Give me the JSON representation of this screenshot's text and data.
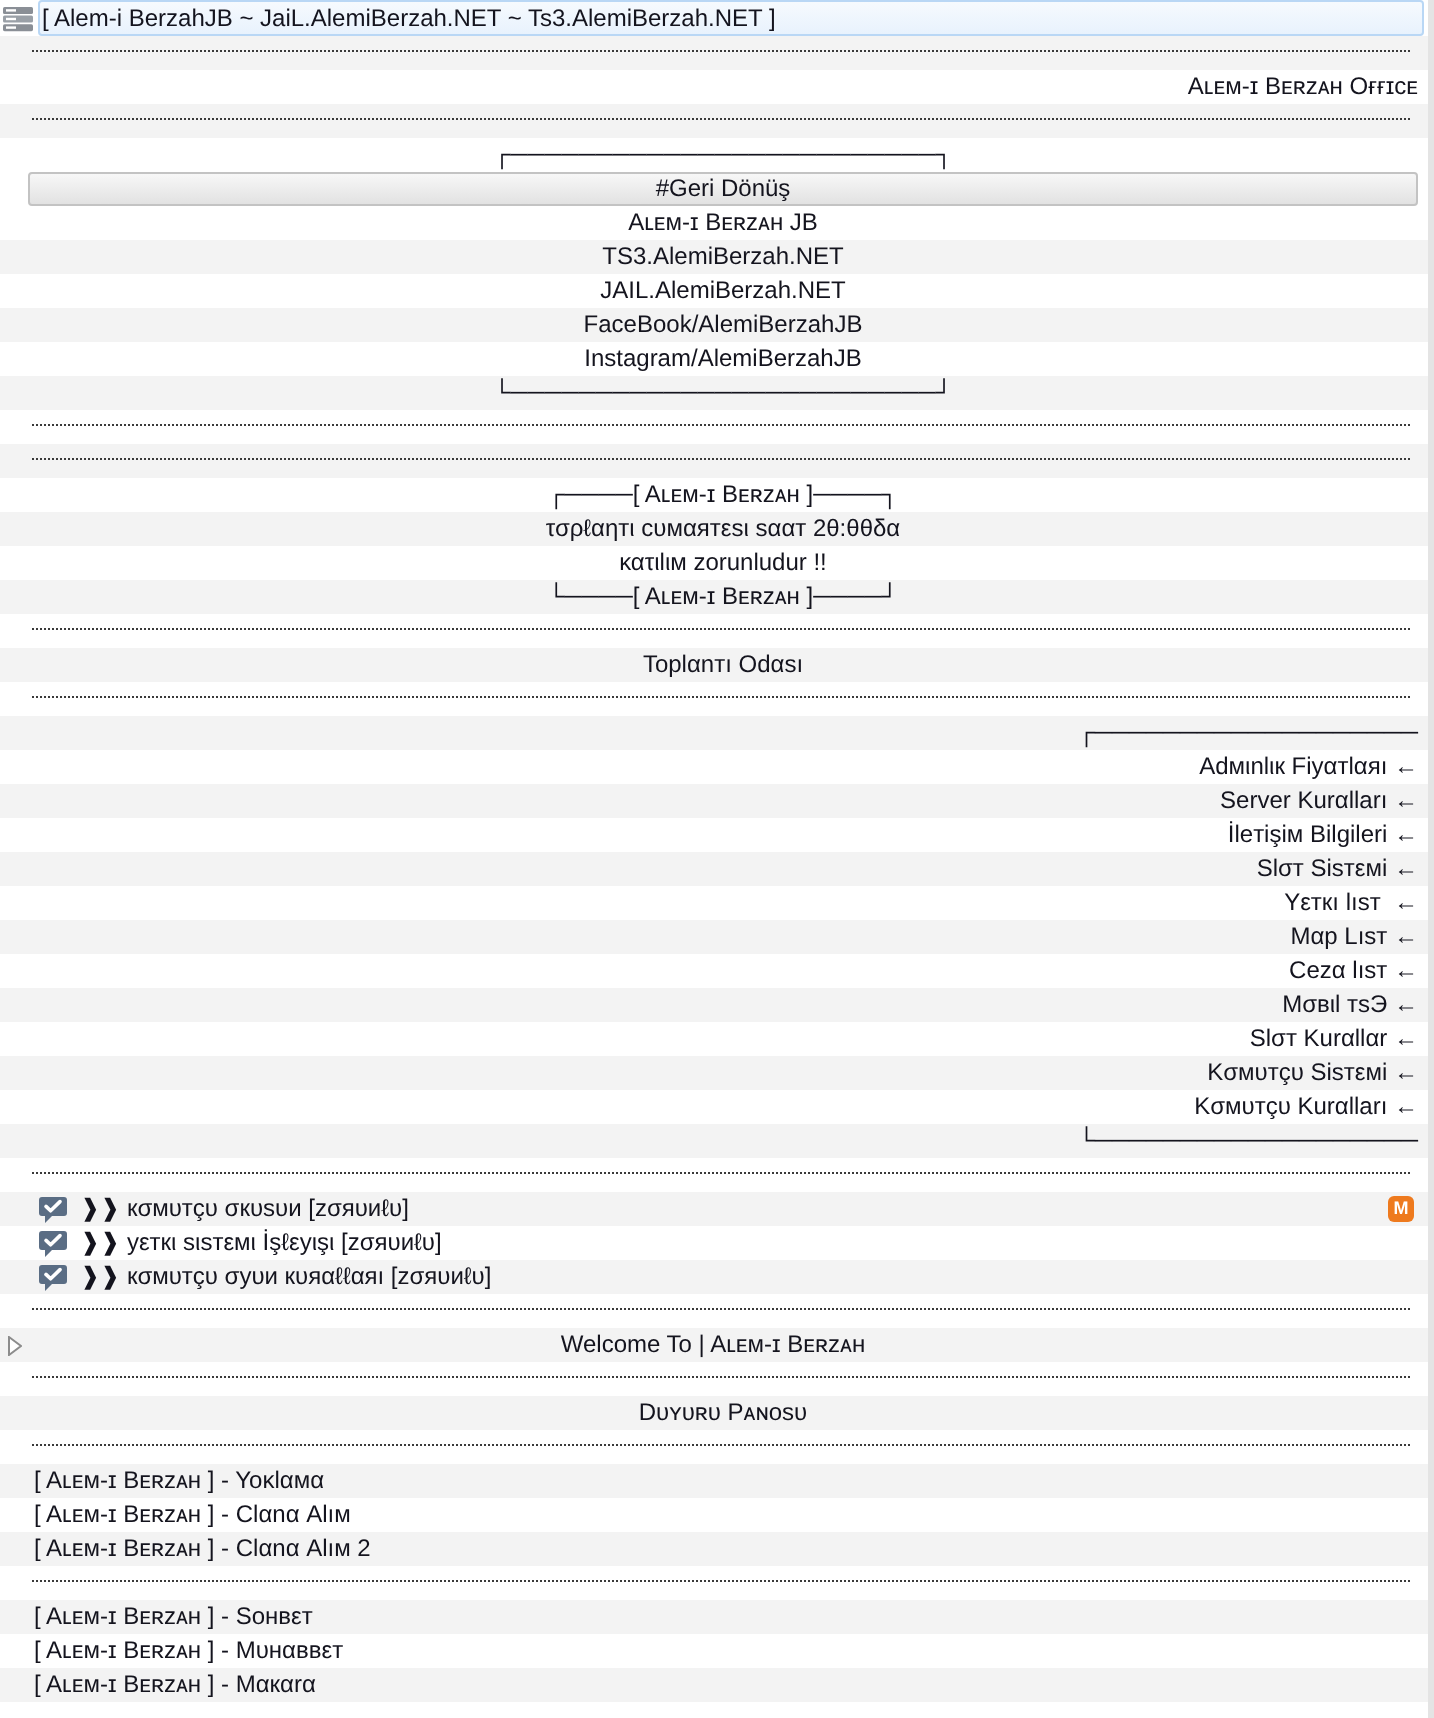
{
  "server": {
    "name": "[ Alem-i BerzahJB ~ JaiL.AlemiBerzah.NET ~ Ts3.AlemiBerzah.NET ]",
    "highlighted": true
  },
  "channels": [
    {
      "kind": "spacer",
      "selected": false
    },
    {
      "kind": "right",
      "text": "Aʟᴇᴍ-ɪ Bᴇʀᴢᴀʜ Oғғɪᴄᴇ",
      "selected": false
    },
    {
      "kind": "spacer",
      "selected": false
    },
    {
      "kind": "center",
      "text": "┌─────────────────────────┐",
      "selected": false
    },
    {
      "kind": "center",
      "text": "#Geri Dönüş",
      "selected": true
    },
    {
      "kind": "center",
      "text": "Aʟᴇᴍ-ɪ Bᴇʀᴢᴀʜ JB",
      "selected": false
    },
    {
      "kind": "center",
      "text": "TS3.AlemiBerzah.NET",
      "selected": false
    },
    {
      "kind": "center",
      "text": "JAIL.AlemiBerzah.NET",
      "selected": false
    },
    {
      "kind": "center",
      "text": "FaceBook/AlemiBerzahJB",
      "selected": false
    },
    {
      "kind": "center",
      "text": "Instagram/AlemiBerzahJB",
      "selected": false
    },
    {
      "kind": "center",
      "text": "└─────────────────────────┘",
      "selected": false
    },
    {
      "kind": "spacer",
      "selected": false
    },
    {
      "kind": "spacer",
      "selected": false
    },
    {
      "kind": "center",
      "text": "┌────[ Aʟᴇᴍ-ɪ Bᴇʀᴢᴀʜ ]────┐",
      "selected": false
    },
    {
      "kind": "center",
      "text": "τσρℓαηтι cυмαятεsι sααт 2θ:θθδα",
      "selected": false
    },
    {
      "kind": "center",
      "text": "κατιlιм zorunludur !!",
      "selected": false
    },
    {
      "kind": "center",
      "text": "└────[ Aʟᴇᴍ-ɪ Bᴇʀᴢᴀʜ ]────┘",
      "selected": false
    },
    {
      "kind": "spacer",
      "selected": false
    },
    {
      "kind": "center",
      "text": "Toplαnтı Odαsı",
      "selected": false
    },
    {
      "kind": "spacer",
      "selected": false
    },
    {
      "kind": "right",
      "text": "┌───────────────────",
      "selected": false
    },
    {
      "kind": "right",
      "text": "Adмιnlιк Fiyαтlαяı ←",
      "selected": false
    },
    {
      "kind": "right",
      "text": "Server Kurαlları ←",
      "selected": false
    },
    {
      "kind": "right",
      "text": "İleтişiм Bilgileri ←",
      "selected": false
    },
    {
      "kind": "right",
      "text": "Slσт Sisтεмi ←",
      "selected": false
    },
    {
      "kind": "right",
      "text": "Yεткı lısт  ←",
      "selected": false
    },
    {
      "kind": "right",
      "text": "Mαp Lısт ←",
      "selected": false
    },
    {
      "kind": "right",
      "text": "Cezα lısт ←",
      "selected": false
    },
    {
      "kind": "right",
      "text": "Mσвιl тsЭ ←",
      "selected": false
    },
    {
      "kind": "right",
      "text": "Slσт Kurαllαr ←",
      "selected": false
    },
    {
      "kind": "right",
      "text": "Kσмυтçυ Sisтεмi ←",
      "selected": false
    },
    {
      "kind": "right",
      "text": "Kσмυтçυ Kurαlları ←",
      "selected": false
    },
    {
      "kind": "right",
      "text": "└───────────────────",
      "selected": false
    },
    {
      "kind": "spacer",
      "selected": false
    },
    {
      "kind": "room",
      "text": "❱❱ кσмυтçυ σкυsυи [zσяυиℓυ]",
      "badge": "M",
      "selected": false
    },
    {
      "kind": "room",
      "text": "❱❱ уεткι sιsтεмι İşℓεyιşι [zσяυиℓυ]",
      "selected": false
    },
    {
      "kind": "room",
      "text": "❱❱ кσмυтçυ σуυи кυяαℓℓαяı [zσяυиℓυ]",
      "selected": false
    },
    {
      "kind": "spacer",
      "selected": false
    },
    {
      "kind": "group",
      "text": "Welcome To | Aʟᴇᴍ-ɪ Bᴇʀᴢᴀʜ",
      "expanded": false,
      "selected": false
    },
    {
      "kind": "spacer",
      "selected": false
    },
    {
      "kind": "center",
      "text": "Dᴜʏᴜʀᴜ Pᴀɴᴏsᴜ",
      "selected": false
    },
    {
      "kind": "spacer",
      "selected": false
    },
    {
      "kind": "left",
      "text": "[ Aʟᴇᴍ-ɪ Bᴇʀᴢᴀʜ ] - Yoκlαмα",
      "selected": false
    },
    {
      "kind": "left",
      "text": "[ Aʟᴇᴍ-ɪ Bᴇʀᴢᴀʜ ] - Clαnα Alıм",
      "selected": false
    },
    {
      "kind": "left",
      "text": "[ Aʟᴇᴍ-ɪ Bᴇʀᴢᴀʜ ] - Clαnα Alıм 2",
      "selected": false
    },
    {
      "kind": "spacer",
      "selected": false
    },
    {
      "kind": "left",
      "text": "[ Aʟᴇᴍ-ɪ Bᴇʀᴢᴀʜ ] - Soнвεт",
      "selected": false
    },
    {
      "kind": "left",
      "text": "[ Aʟᴇᴍ-ɪ Bᴇʀᴢᴀʜ ] - Mυнαввεт",
      "selected": false
    },
    {
      "kind": "left",
      "text": "[ Aʟᴇᴍ-ɪ Bᴇʀᴢᴀʜ ] - Mαкαrα",
      "selected": false
    }
  ]
}
